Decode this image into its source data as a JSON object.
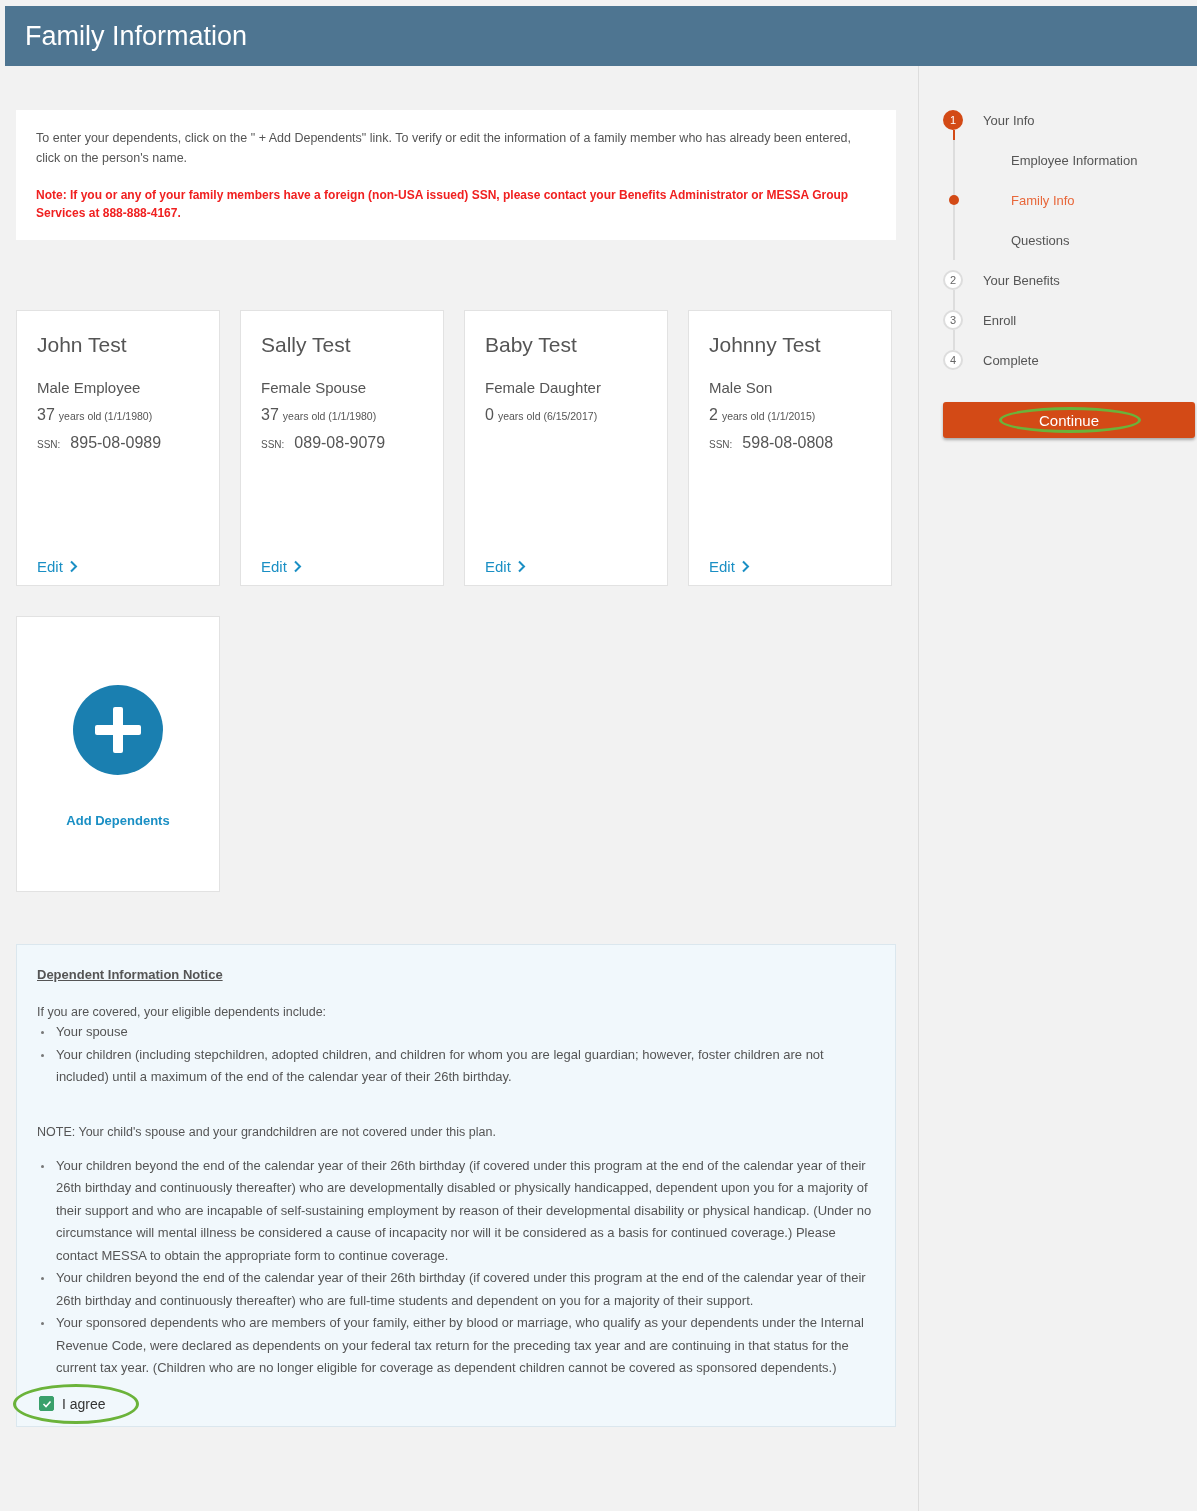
{
  "header": {
    "title": "Family Information"
  },
  "intro": {
    "text": "To enter your dependents, click on the \" + Add Dependents\" link. To verify or edit the information of a family member who has already been entered, click on the person's name.",
    "note": "Note: If you or any of your family members have a foreign (non-USA issued) SSN, please contact your Benefits Administrator or MESSA Group Services at 888-888-4167."
  },
  "members": [
    {
      "name": "John Test",
      "role": "Male Employee",
      "age": "37",
      "age_detail": "years old (1/1/1980)",
      "ssn_label": "SSN:",
      "ssn": "895-08-0989",
      "edit": "Edit"
    },
    {
      "name": "Sally Test",
      "role": "Female Spouse",
      "age": "37",
      "age_detail": "years old (1/1/1980)",
      "ssn_label": "SSN:",
      "ssn": "089-08-9079",
      "edit": "Edit"
    },
    {
      "name": "Baby Test",
      "role": "Female Daughter",
      "age": "0",
      "age_detail": "years old (6/15/2017)",
      "edit": "Edit"
    },
    {
      "name": "Johnny Test",
      "role": "Male Son",
      "age": "2",
      "age_detail": "years old (1/1/2015)",
      "ssn_label": "SSN:",
      "ssn": "598-08-0808",
      "edit": "Edit"
    }
  ],
  "add_dependents": {
    "label": "Add Dependents"
  },
  "notice": {
    "title": "Dependent Information Notice",
    "intro": "If you are covered, your eligible dependents include:",
    "list_1": [
      "Your spouse",
      "Your children (including stepchildren, adopted children, and children for whom you are legal guardian; however, foster children are not included) until a maximum of the end of the calendar year of their 26th birthday."
    ],
    "note": "NOTE: Your child's spouse and your grandchildren are not covered under this plan.",
    "list_2": [
      "Your children beyond the end of the calendar year of their 26th birthday (if covered under this program at the end of the calendar year of their 26th birthday and continuously thereafter) who are developmentally disabled or physically handicapped, dependent upon you for a majority of their support and who are incapable of self-sustaining employment by reason of their developmental disability or physical handicap. (Under no circumstance will mental illness be considered a cause of incapacity nor will it be considered as a basis for continued coverage.) Please contact MESSA to obtain the appropriate form to continue coverage.",
      "Your children beyond the end of the calendar year of their 26th birthday (if covered under this program at the end of the calendar year of their 26th birthday and continuously thereafter) who are full-time students and dependent on you for a majority of their support.",
      "Your sponsored dependents who are members of your family, either by blood or marriage, who qualify as your dependents under the Internal Revenue Code, were declared as dependents on your federal tax return for the preceding tax year and are continuing in that status for the current tax year. (Children who are no longer eligible for coverage as dependent children cannot be covered as sponsored dependents.)"
    ],
    "agree": {
      "label": "I agree",
      "checked": true
    }
  },
  "steps": [
    {
      "number": "1",
      "label": "Your Info",
      "selected": true,
      "children": [
        {
          "label": "Employee Information",
          "selected": false
        },
        {
          "label": "Family Info",
          "selected": true
        },
        {
          "label": "Questions",
          "selected": false
        }
      ]
    },
    {
      "number": "2",
      "label": "Your Benefits",
      "selected": false
    },
    {
      "number": "3",
      "label": "Enroll",
      "selected": false
    },
    {
      "number": "4",
      "label": "Complete",
      "selected": false
    }
  ],
  "continue_button": {
    "label": "Continue"
  }
}
